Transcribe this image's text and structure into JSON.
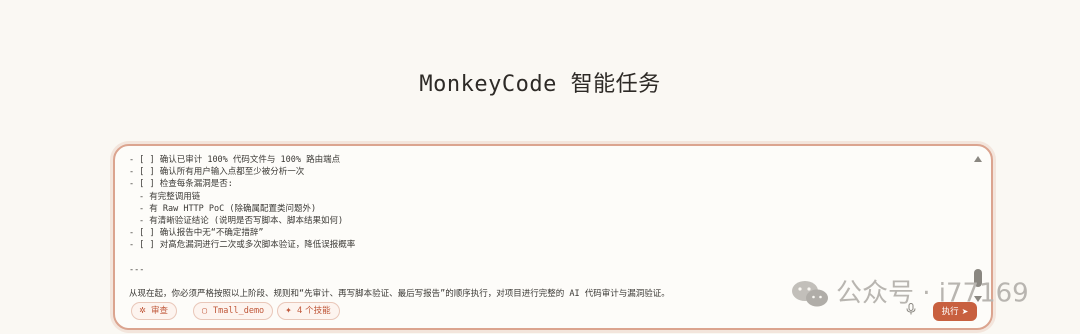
{
  "page": {
    "title": "MonkeyCode 智能任务"
  },
  "editor": {
    "lines": [
      {
        "text": "- [ ] 确认已审计 100% 代码文件与 100% 路由端点",
        "indent": false
      },
      {
        "text": "- [ ] 确认所有用户输入点都至少被分析一次",
        "indent": false
      },
      {
        "text": "- [ ] 检查每条漏洞是否:",
        "indent": false
      },
      {
        "text": "- 有完整调用链",
        "indent": true
      },
      {
        "text": "- 有 Raw HTTP PoC (除确属配置类问题外)",
        "indent": true
      },
      {
        "text": "- 有清晰验证结论 (说明是否写脚本、脚本结果如何)",
        "indent": true
      },
      {
        "text": "- [ ] 确认报告中无“不确定措辞”",
        "indent": false
      },
      {
        "text": "- [ ] 对高危漏洞进行二次或多次脚本验证，降低误报概率",
        "indent": false
      },
      {
        "text": "",
        "indent": false
      },
      {
        "text": "---",
        "indent": false
      },
      {
        "text": "",
        "indent": false
      },
      {
        "text": "从现在起，你必须严格按照以上阶段、规则和“先审计、再写脚本验证、最后写报告”的顺序执行，对项目进行完整的 AI 代码审计与漏洞验证。",
        "indent": false
      }
    ]
  },
  "toolbar": {
    "review_label": "审查",
    "repo_label": "Tmall_demo",
    "skills_label": "4 个技能",
    "run_label": "执行"
  },
  "watermark": {
    "text": "公众号 · i77169"
  },
  "colors": {
    "accent": "#c8603f",
    "border": "#dba48f",
    "background": "#faf8f3"
  },
  "icons": {
    "review": "bug-icon",
    "repo": "repo-icon",
    "skills": "skills-icon",
    "mic": "microphone-icon",
    "send": "send-icon",
    "watermark": "wechat-icon"
  }
}
